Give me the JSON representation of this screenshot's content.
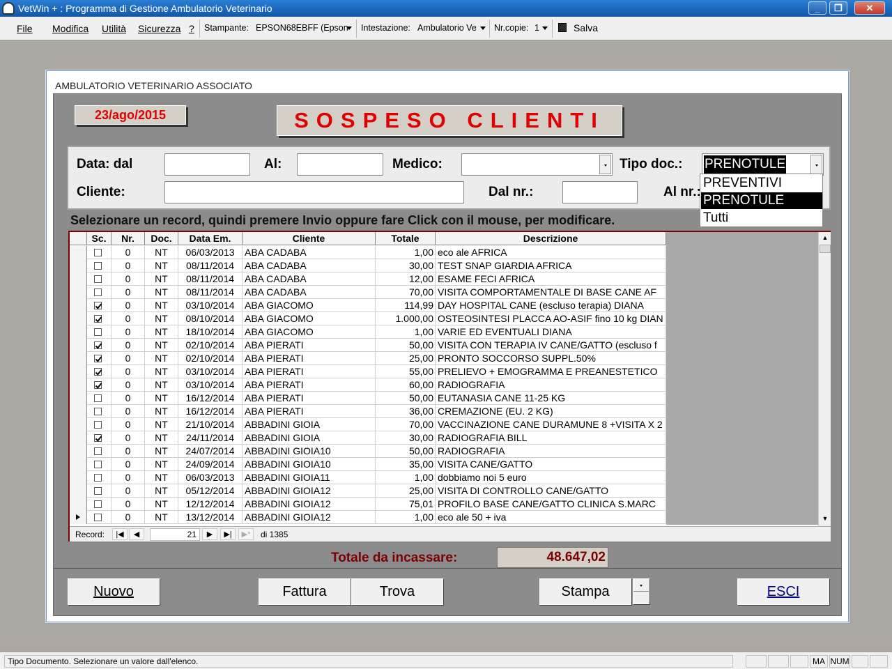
{
  "window": {
    "title": "VetWin + : Programma di Gestione Ambulatorio Veterinario",
    "min": "_",
    "max": "❐",
    "close": "✕"
  },
  "menu": {
    "file": "File",
    "modifica": "Modifica",
    "utilita": "Utilità",
    "sicurezza": "Sicurezza",
    "help": "?"
  },
  "toolbar": {
    "stampante_label": "Stampante:",
    "stampante_value": "EPSON68EBFF (Epson",
    "intestazione_label": "Intestazione:",
    "intestazione_value": "Ambulatorio Ve",
    "copie_label": "Nr.copie:",
    "copie_value": "1",
    "salva": "Salva"
  },
  "form": {
    "caption": "AMBULATORIO VETERINARIO ASSOCIATO",
    "date": "23/ago/2015",
    "title": "SOSPESO CLIENTI"
  },
  "filters": {
    "data_dal": "Data: dal",
    "al": "Al:",
    "medico": "Medico:",
    "tipo_doc": "Tipo doc.:",
    "tipo_doc_value": "PRENOTULE",
    "cliente": "Cliente:",
    "dal_nr": "Dal nr.:",
    "al_nr": "Al nr.:"
  },
  "dropdown": {
    "options": [
      "PREVENTIVI",
      "PRENOTULE",
      "Tutti"
    ],
    "selected": "PRENOTULE"
  },
  "hint": "Selezionare un record, quindi premere Invio oppure fare Click con il mouse, per modificare.",
  "grid": {
    "headers": [
      "Sc.",
      "Nr.",
      "Doc.",
      "Data Em.",
      "Cliente",
      "Totale",
      "Descrizione"
    ],
    "rows": [
      {
        "sc": false,
        "nr": "0",
        "doc": "NT",
        "data": "06/03/2013",
        "cliente": "ABA CADABA",
        "totale": "1,00",
        "desc": "eco ale AFRICA"
      },
      {
        "sc": false,
        "nr": "0",
        "doc": "NT",
        "data": "08/11/2014",
        "cliente": "ABA CADABA",
        "totale": "30,00",
        "desc": "TEST SNAP GIARDIA AFRICA"
      },
      {
        "sc": false,
        "nr": "0",
        "doc": "NT",
        "data": "08/11/2014",
        "cliente": "ABA CADABA",
        "totale": "12,00",
        "desc": "ESAME FECI AFRICA"
      },
      {
        "sc": false,
        "nr": "0",
        "doc": "NT",
        "data": "08/11/2014",
        "cliente": "ABA CADABA",
        "totale": "70,00",
        "desc": "VISITA COMPORTAMENTALE DI BASE CANE AF"
      },
      {
        "sc": true,
        "nr": "0",
        "doc": "NT",
        "data": "03/10/2014",
        "cliente": "ABA GIACOMO",
        "totale": "114,99",
        "desc": "DAY HOSPITAL CANE (escluso terapia) DIANA"
      },
      {
        "sc": true,
        "nr": "0",
        "doc": "NT",
        "data": "08/10/2014",
        "cliente": "ABA GIACOMO",
        "totale": "1.000,00",
        "desc": "OSTEOSINTESI PLACCA AO-ASIF fino 10 kg DIAN"
      },
      {
        "sc": false,
        "nr": "0",
        "doc": "NT",
        "data": "18/10/2014",
        "cliente": "ABA GIACOMO",
        "totale": "1,00",
        "desc": "VARIE ED EVENTUALI DIANA"
      },
      {
        "sc": true,
        "nr": "0",
        "doc": "NT",
        "data": "02/10/2014",
        "cliente": "ABA PIERATI",
        "totale": "50,00",
        "desc": "VISITA CON TERAPIA IV CANE/GATTO (escluso f"
      },
      {
        "sc": true,
        "nr": "0",
        "doc": "NT",
        "data": "02/10/2014",
        "cliente": "ABA PIERATI",
        "totale": "25,00",
        "desc": "PRONTO SOCCORSO  SUPPL.50%"
      },
      {
        "sc": true,
        "nr": "0",
        "doc": "NT",
        "data": "03/10/2014",
        "cliente": "ABA PIERATI",
        "totale": "55,00",
        "desc": "PRELIEVO + EMOGRAMMA E PREANESTETICO"
      },
      {
        "sc": true,
        "nr": "0",
        "doc": "NT",
        "data": "03/10/2014",
        "cliente": "ABA PIERATI",
        "totale": "60,00",
        "desc": "RADIOGRAFIA"
      },
      {
        "sc": false,
        "nr": "0",
        "doc": "NT",
        "data": "16/12/2014",
        "cliente": "ABA PIERATI",
        "totale": "50,00",
        "desc": "EUTANASIA CANE 11-25 KG"
      },
      {
        "sc": false,
        "nr": "0",
        "doc": "NT",
        "data": "16/12/2014",
        "cliente": "ABA PIERATI",
        "totale": "36,00",
        "desc": "CREMAZIONE   (EU. 2 KG)"
      },
      {
        "sc": false,
        "nr": "0",
        "doc": "NT",
        "data": "21/10/2014",
        "cliente": "ABBADINI GIOIA",
        "totale": "70,00",
        "desc": "VACCINAZIONE  CANE DURAMUNE 8 +VISITA X 2"
      },
      {
        "sc": true,
        "nr": "0",
        "doc": "NT",
        "data": "24/11/2014",
        "cliente": "ABBADINI GIOIA",
        "totale": "30,00",
        "desc": "RADIOGRAFIA BILL"
      },
      {
        "sc": false,
        "nr": "0",
        "doc": "NT",
        "data": "24/07/2014",
        "cliente": "ABBADINI GIOIA10",
        "totale": "50,00",
        "desc": "RADIOGRAFIA"
      },
      {
        "sc": false,
        "nr": "0",
        "doc": "NT",
        "data": "24/09/2014",
        "cliente": "ABBADINI GIOIA10",
        "totale": "35,00",
        "desc": "VISITA CANE/GATTO"
      },
      {
        "sc": false,
        "nr": "0",
        "doc": "NT",
        "data": "06/03/2013",
        "cliente": "ABBADINI GIOIA11",
        "totale": "1,00",
        "desc": "dobbiamo noi 5 euro"
      },
      {
        "sc": false,
        "nr": "0",
        "doc": "NT",
        "data": "05/12/2014",
        "cliente": "ABBADINI GIOIA12",
        "totale": "25,00",
        "desc": "VISITA DI CONTROLLO CANE/GATTO"
      },
      {
        "sc": false,
        "nr": "0",
        "doc": "NT",
        "data": "12/12/2014",
        "cliente": "ABBADINI GIOIA12",
        "totale": "75,01",
        "desc": "PROFILO BASE CANE/GATTO CLINICA S.MARC"
      },
      {
        "sc": false,
        "nr": "0",
        "doc": "NT",
        "data": "13/12/2014",
        "cliente": "ABBADINI GIOIA12",
        "totale": "1,00",
        "desc": "eco ale 50 + iva",
        "current": true
      }
    ]
  },
  "recnav": {
    "label": "Record:",
    "current": "21",
    "of": "di 1385",
    "first": "|◀",
    "prev": "◀",
    "next": "▶",
    "last": "▶|",
    "new": "▶*"
  },
  "totals": {
    "label": "Totale da incassare:",
    "value": "48.647,02"
  },
  "buttons": {
    "nuovo": "Nuovo",
    "fattura": "Fattura",
    "trova": "Trova",
    "stampa": "Stampa",
    "esci": "ESCI"
  },
  "status": {
    "text": "Tipo Documento. Selezionare un valore dall'elenco.",
    "ma": "MA",
    "num": "NUM"
  }
}
